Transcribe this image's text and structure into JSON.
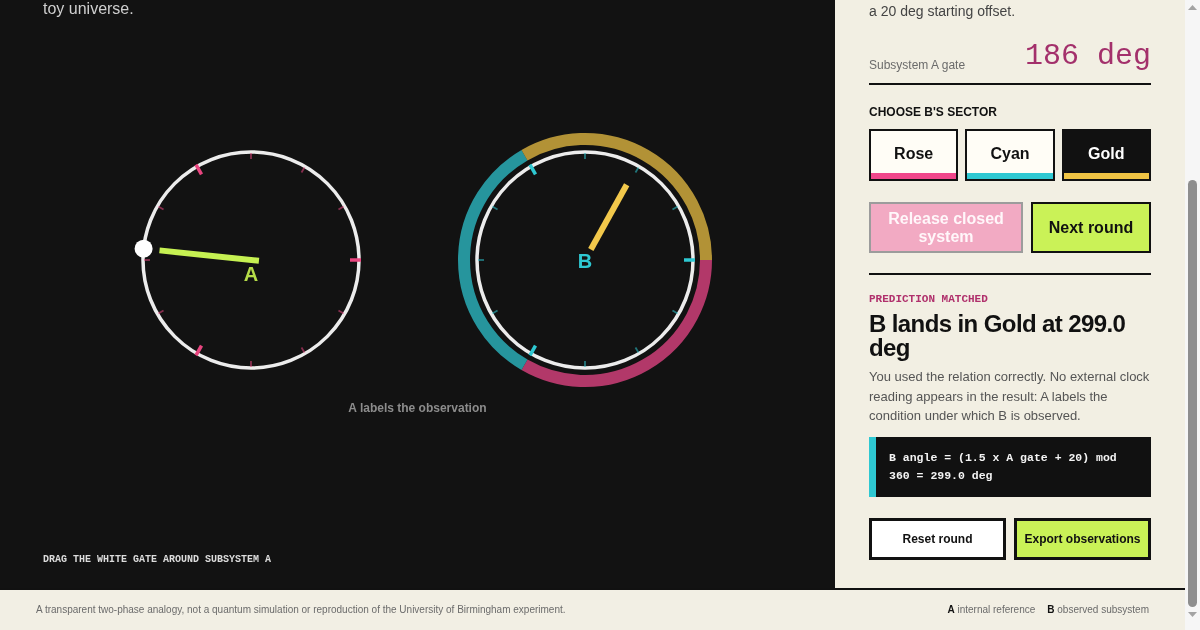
{
  "universe_panel": {
    "intro_tail": "toy universe.",
    "subsystem_a": {
      "label": "A"
    },
    "subsystem_b": {
      "label": "B"
    },
    "caption": "A labels the observation",
    "instruction": "DRAG THE WHITE GATE AROUND SUBSYSTEM A"
  },
  "control_panel": {
    "intro_tail": "a 20 deg starting offset.",
    "gate_reading": {
      "label": "Subsystem A gate",
      "value": "186 deg"
    },
    "sector_choice": {
      "heading": "CHOOSE B'S SECTOR",
      "options": [
        {
          "label": "Rose",
          "color": "#f0468a",
          "selected": false
        },
        {
          "label": "Cyan",
          "color": "#2ec8d2",
          "selected": false
        },
        {
          "label": "Gold",
          "color": "#f0c444",
          "selected": true
        }
      ]
    },
    "actions": [
      {
        "kind": "release",
        "label": "Release closed system",
        "disabled": true
      },
      {
        "kind": "next",
        "label": "Next round",
        "disabled": false
      }
    ],
    "result": {
      "status": "PREDICTION MATCHED",
      "title": "B lands in Gold at 299.0 deg",
      "explanation": "You used the relation correctly. No external clock reading appears in the result: A labels the condition under which B is observed.",
      "formula": "B angle = (1.5 x A gate + 20) mod 360 = 299.0 deg"
    },
    "footer_actions": [
      {
        "kind": "reset",
        "label": "Reset round"
      },
      {
        "kind": "export",
        "label": "Export observations"
      }
    ]
  },
  "footer": {
    "disclaimer": "A transparent two-phase analogy, not a quantum simulation or reproduction of the University of Birmingham experiment.",
    "legend": [
      "**A** internal reference",
      "**B** observed subsystem"
    ]
  }
}
